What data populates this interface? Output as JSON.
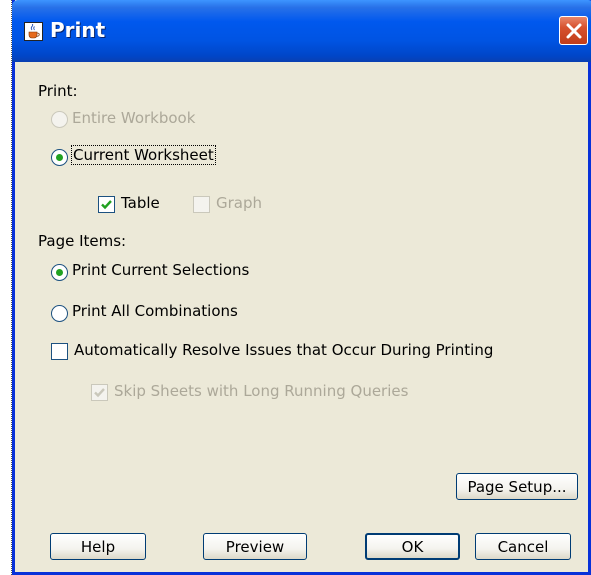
{
  "window": {
    "title": "Print",
    "title_icon": "java-cup-icon",
    "close_icon": "close-x-icon"
  },
  "print_section": {
    "label": "Print:",
    "options": [
      {
        "label": "Entire Workbook",
        "selected": false,
        "enabled": false
      },
      {
        "label": "Current Worksheet",
        "selected": true,
        "enabled": true
      }
    ],
    "table": {
      "label": "Table",
      "checked": true,
      "enabled": true
    },
    "graph": {
      "label": "Graph",
      "checked": false,
      "enabled": false
    }
  },
  "page_items": {
    "label": "Page Items:",
    "options": [
      {
        "label": "Print Current Selections",
        "selected": true,
        "enabled": true
      },
      {
        "label": "Print All Combinations",
        "selected": false,
        "enabled": true
      }
    ]
  },
  "auto_resolve": {
    "label": "Automatically Resolve Issues that Occur During Printing",
    "checked": false,
    "enabled": true
  },
  "skip_sheets": {
    "label": "Skip Sheets with Long Running Queries",
    "checked": true,
    "enabled": false
  },
  "buttons": {
    "page_setup": "Page Setup...",
    "help": "Help",
    "preview": "Preview",
    "ok": "OK",
    "cancel": "Cancel"
  },
  "colors": {
    "titlebar": "#0054e3",
    "dialog_bg": "#ece9d8",
    "radio_dot": "#21a121",
    "check_mark": "#21a121",
    "close_button": "#d6512e",
    "disabled_text": "#aca899"
  }
}
